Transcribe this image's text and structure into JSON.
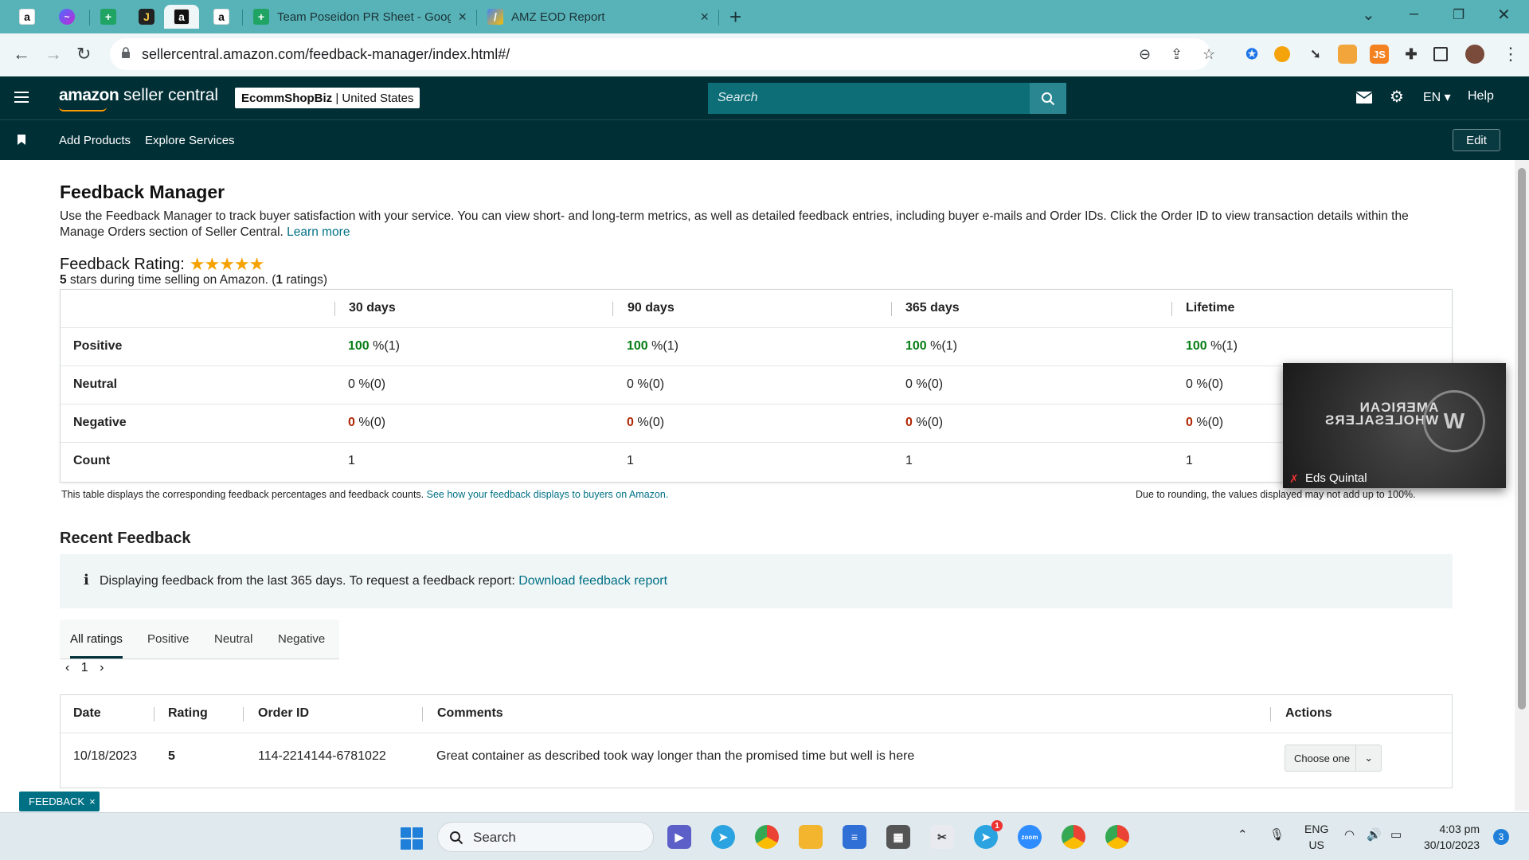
{
  "browser": {
    "tabs": [
      {
        "title": "Team Poseidon PR Sheet - Goog"
      },
      {
        "title": "AMZ EOD Report"
      }
    ],
    "url": "sellercentral.amazon.com/feedback-manager/index.html#/",
    "new_tab": "+",
    "ext_js": "JS"
  },
  "header": {
    "brand_main": "amazon",
    "brand_rest": " seller central",
    "store_name": "EcommShopBiz",
    "store_sep": " | ",
    "store_region": "United States",
    "search_placeholder": "Search",
    "language": "EN",
    "help": "Help"
  },
  "nav": {
    "add_products": "Add Products",
    "explore_services": "Explore Services",
    "edit": "Edit"
  },
  "page": {
    "title": "Feedback Manager",
    "intro": "Use the Feedback Manager to track buyer satisfaction with your service. You can view short- and long-term metrics, as well as detailed feedback entries, including buyer e-mails and Order IDs. Click the Order ID to view transaction details within the Manage Orders section of Seller Central.",
    "learn_more": "Learn more",
    "rating_label": "Feedback Rating:",
    "stars": "★★★★★",
    "rating_stars": "5",
    "rating_mid": " stars during time selling on Amazon. (",
    "rating_count": "1",
    "rating_end": " ratings)"
  },
  "metrics": {
    "columns": [
      "30 days",
      "90 days",
      "365 days",
      "Lifetime"
    ],
    "rows": [
      {
        "label": "Positive",
        "cells": [
          {
            "v": "100",
            "r": " %(1)"
          },
          {
            "v": "100",
            "r": " %(1)"
          },
          {
            "v": "100",
            "r": " %(1)"
          },
          {
            "v": "100",
            "r": " %(1)"
          }
        ]
      },
      {
        "label": "Neutral",
        "cells": [
          {
            "v": "0",
            "r": " %(0)"
          },
          {
            "v": "0",
            "r": " %(0)"
          },
          {
            "v": "0",
            "r": " %(0)"
          },
          {
            "v": "0",
            "r": " %(0)"
          }
        ]
      },
      {
        "label": "Negative",
        "cells": [
          {
            "v": "0",
            "r": " %(0)"
          },
          {
            "v": "0",
            "r": " %(0)"
          },
          {
            "v": "0",
            "r": " %(0)"
          },
          {
            "v": "0",
            "r": " %(0)"
          }
        ]
      },
      {
        "label": "Count",
        "cells": [
          {
            "v": "1",
            "r": ""
          },
          {
            "v": "1",
            "r": ""
          },
          {
            "v": "1",
            "r": ""
          },
          {
            "v": "1",
            "r": ""
          }
        ]
      }
    ],
    "note_left": "This table displays the corresponding feedback percentages and feedback counts.",
    "note_link": "See how your feedback displays to buyers on Amazon.",
    "note_right": "Due to rounding, the values displayed may not add up to 100%."
  },
  "recent": {
    "title": "Recent Feedback",
    "info": "Displaying feedback from the last 365 days. To request a feedback report:",
    "info_link": "Download feedback report",
    "tabs": [
      "All ratings",
      "Positive",
      "Neutral",
      "Negative"
    ],
    "page": "1",
    "headers": {
      "date": "Date",
      "rating": "Rating",
      "order_id": "Order ID",
      "comments": "Comments",
      "actions": "Actions"
    },
    "row": {
      "date": "10/18/2023",
      "rating": "5",
      "order_id": "114-2214144-6781022",
      "comment": "Great container as described took way longer than the promised time but well is here",
      "action": "Choose one"
    }
  },
  "feedback_tag": "FEEDBACK",
  "video": {
    "name": "Eds Quintal",
    "logo_line1": "AMERICAN",
    "logo_line2": "WHOLESALERS",
    "logo_mark": "W"
  },
  "taskbar": {
    "search": "Search",
    "lang_line1": "ENG",
    "lang_line2": "US",
    "time": "4:03 pm",
    "date": "30/10/2023",
    "notifications": "3",
    "telegram_badge": "1"
  }
}
